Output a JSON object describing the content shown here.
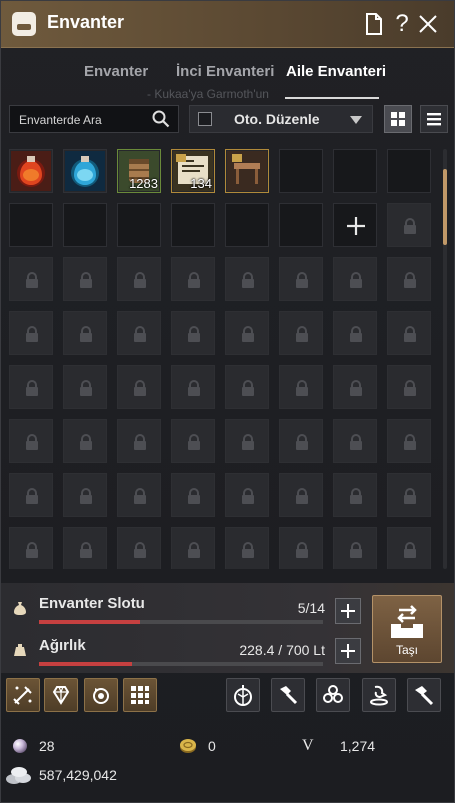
{
  "window": {
    "title": "Envanter",
    "controls": [
      "document-icon",
      "help-icon",
      "close-icon"
    ]
  },
  "tabs": [
    {
      "label": "Envanter",
      "active": false
    },
    {
      "label": "İnci Envanteri",
      "active": false
    },
    {
      "label": "Aile Envanteri",
      "active": true
    }
  ],
  "ghost_text": "- Kukaa'ya Garmoth'un",
  "search": {
    "placeholder": "Envanterde Ara",
    "value": ""
  },
  "sort": {
    "label": "Oto. Düzenle",
    "checked": false
  },
  "view_modes": [
    "grid-view-icon",
    "list-view-icon"
  ],
  "active_view": "grid",
  "items": [
    {
      "name": "red-potion-icon",
      "qty": ""
    },
    {
      "name": "blue-potion-icon",
      "qty": ""
    },
    {
      "name": "barrel-icon",
      "qty": "1283"
    },
    {
      "name": "scroll-icon",
      "qty": "134"
    },
    {
      "name": "table-icon",
      "qty": ""
    }
  ],
  "slots": {
    "open_empty": 9,
    "add_slot": 1,
    "locked": 57,
    "columns": 8
  },
  "stats": {
    "slot_label": "Envanter Slotu",
    "slot_value": "5/14",
    "slot_fraction": 0.357,
    "weight_label": "Ağırlık",
    "weight_value": "228.4 / 700 Lt",
    "weight_fraction": 0.326
  },
  "move_button": {
    "label": "Taşı"
  },
  "tools_left": [
    "sword-enhance-icon",
    "gem-icon",
    "cycle-icon",
    "grid-craft-icon"
  ],
  "tools_right": [
    "alchemy-stone-icon",
    "hammer-icon",
    "knot-icon",
    "manos-icon",
    "repair-hammer-icon"
  ],
  "currencies": {
    "pearls": "28",
    "tokens": "0",
    "v_label": "V",
    "v_value": "1,274",
    "silver": "587,429,042"
  },
  "colors": {
    "accent": "#c09868",
    "bar_red": "#c64040",
    "title_bg": "#6f5a3d"
  }
}
